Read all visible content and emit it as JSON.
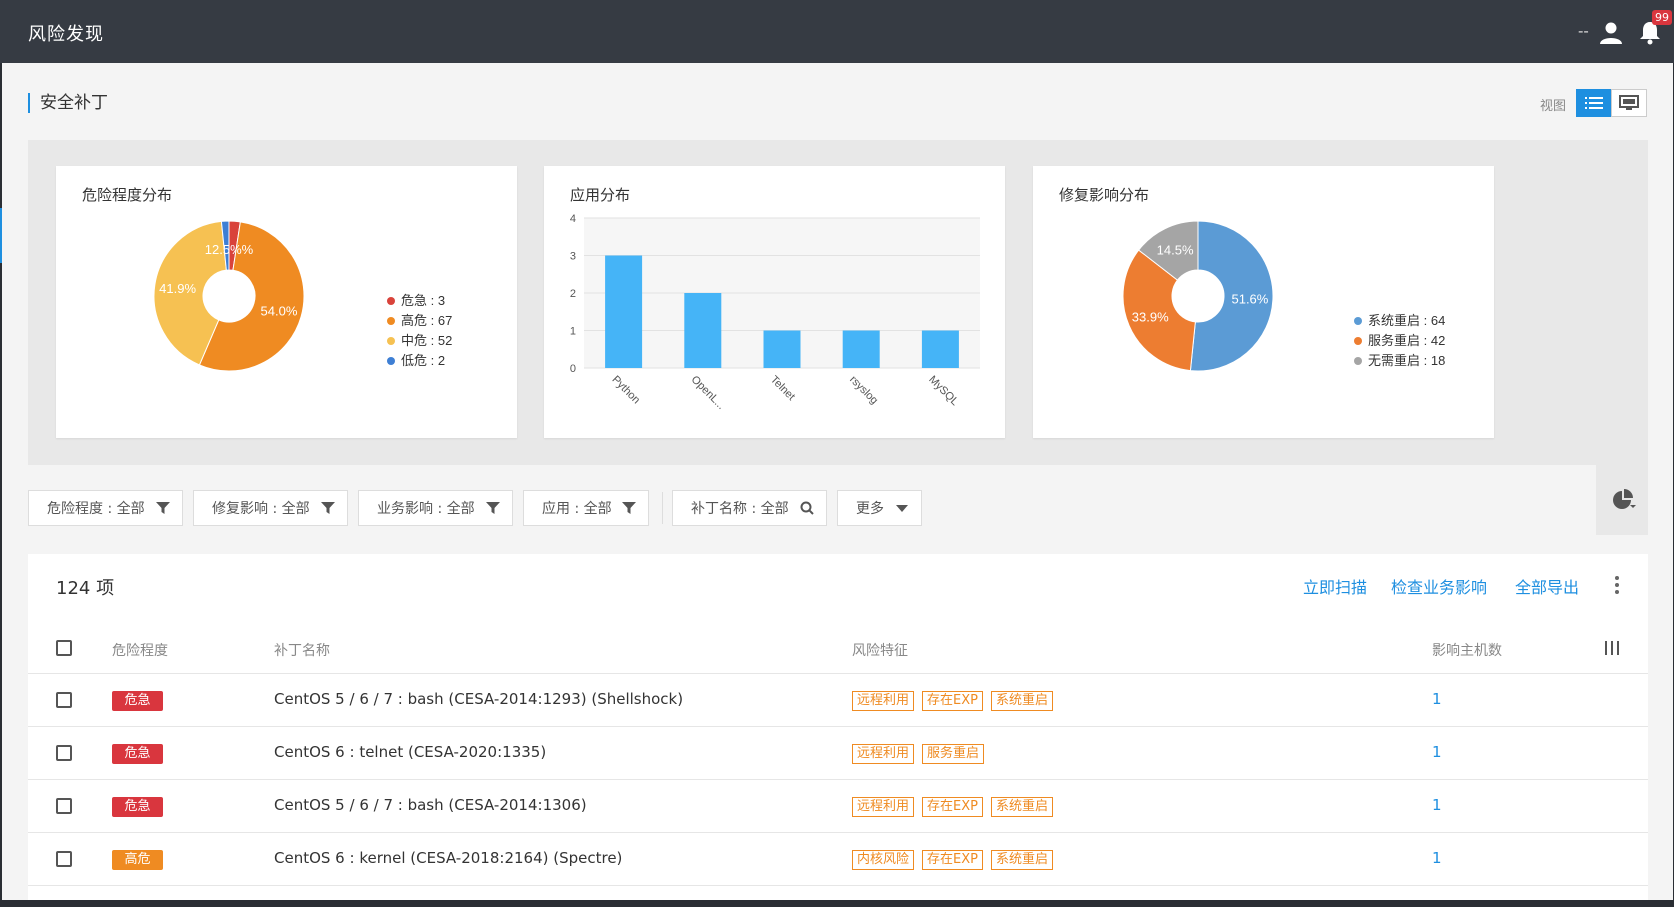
{
  "header": {
    "title": "风险发现",
    "user_text": "--",
    "badge": "99"
  },
  "section": {
    "title": "安全补丁",
    "view_label": "视图"
  },
  "charts": {
    "severity": {
      "title": "危险程度分布"
    },
    "app": {
      "title": "应用分布"
    },
    "impact": {
      "title": "修复影响分布"
    }
  },
  "chart_data": [
    {
      "type": "pie",
      "title": "危险程度分布",
      "labels": [
        "危急",
        "高危",
        "中危",
        "低危"
      ],
      "values": [
        3,
        67,
        52,
        2
      ],
      "percent_labels": [
        "2.4%",
        "54.0%",
        "41.9%",
        "1.6%"
      ],
      "center_label_overlap": "12.5%%",
      "legend": [
        "危急 : 3",
        "高危 : 67",
        "中危 : 52",
        "低危 : 2"
      ],
      "colors": [
        "#d9433b",
        "#ef8b22",
        "#f6c152",
        "#3e7fd4"
      ],
      "legend_position": "right"
    },
    {
      "type": "bar",
      "title": "应用分布",
      "categories": [
        "Python",
        "OpenL...",
        "Telnet",
        "rsyslog",
        "MySQL"
      ],
      "values": [
        3,
        2,
        1,
        1,
        1
      ],
      "y_ticks": [
        "0",
        "1",
        "2",
        "3",
        "4"
      ],
      "ylim": [
        0,
        4
      ],
      "color": "#45b4f7",
      "grid": true
    },
    {
      "type": "pie",
      "title": "修复影响分布",
      "labels": [
        "系统重启",
        "服务重启",
        "无需重启"
      ],
      "values": [
        64,
        42,
        18
      ],
      "percent_labels": [
        "51.6%",
        "33.9%",
        "14.5%"
      ],
      "legend": [
        "系统重启 : 64",
        "服务重启 : 42",
        "无需重启 : 18"
      ],
      "colors": [
        "#5b9bd5",
        "#ed7d31",
        "#a5a5a5"
      ],
      "legend_position": "right"
    }
  ],
  "filters": [
    {
      "label": "危险程度 : 全部",
      "icon": "filter-icon"
    },
    {
      "label": "修复影响 : 全部",
      "icon": "filter-icon"
    },
    {
      "label": "业务影响 : 全部",
      "icon": "filter-icon"
    },
    {
      "label": "应用 : 全部",
      "icon": "filter-icon"
    },
    {
      "label": "补丁名称 : 全部",
      "icon": "search-icon"
    },
    {
      "label": "更多",
      "icon": "caret-down-icon"
    }
  ],
  "table": {
    "count": "124 项",
    "actions": [
      "立即扫描",
      "检查业务影响",
      "全部导出"
    ],
    "columns": [
      "危险程度",
      "补丁名称",
      "风险特征",
      "影响主机数"
    ],
    "rows": [
      {
        "severity": "危急",
        "sev_class": "crit",
        "name": "CentOS 5 / 6 / 7 : bash (CESA-2014:1293) (Shellshock)",
        "tags": [
          "远程利用",
          "存在EXP",
          "系统重启"
        ],
        "hosts": "1"
      },
      {
        "severity": "危急",
        "sev_class": "crit",
        "name": "CentOS 6 : telnet (CESA-2020:1335)",
        "tags": [
          "远程利用",
          "服务重启"
        ],
        "hosts": "1"
      },
      {
        "severity": "危急",
        "sev_class": "crit",
        "name": "CentOS 5 / 6 / 7 : bash (CESA-2014:1306)",
        "tags": [
          "远程利用",
          "存在EXP",
          "系统重启"
        ],
        "hosts": "1"
      },
      {
        "severity": "高危",
        "sev_class": "high",
        "name": "CentOS 6 : kernel (CESA-2018:2164) (Spectre)",
        "tags": [
          "内核风险",
          "存在EXP",
          "系统重启"
        ],
        "hosts": "1"
      }
    ]
  }
}
